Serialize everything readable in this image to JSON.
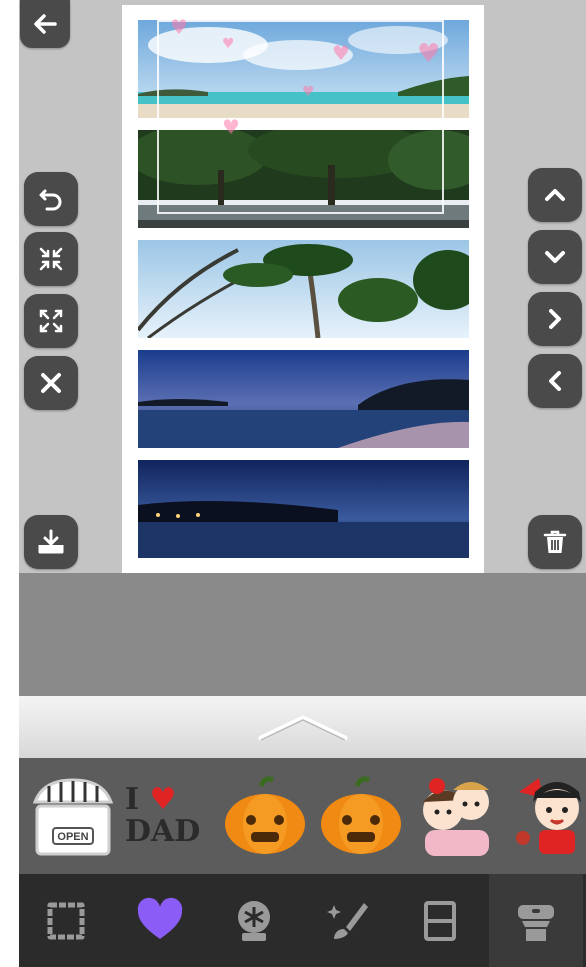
{
  "colors": {
    "toolbar_button": "#4a4a4a",
    "canvas_bg": "#c4c4c4",
    "nav_bg": "#2b2b2b",
    "sticker_bg": "#5c5c5c",
    "heart_accent": "#8b5cf6"
  },
  "stickers": {
    "items": [
      {
        "icon": "shop-awning-icon",
        "sign_text": "OPEN"
      },
      {
        "icon": "i-love-dad-icon",
        "line1": "I",
        "line2": "DAD"
      },
      {
        "icon": "pumpkin-icon"
      },
      {
        "icon": "pumpkin-icon"
      },
      {
        "icon": "cartoon-kids-icon"
      },
      {
        "icon": "cartoon-girl-icon"
      }
    ]
  },
  "nav": {
    "items": [
      {
        "icon": "frame-icon"
      },
      {
        "icon": "heart-icon"
      },
      {
        "icon": "snowglobe-icon"
      },
      {
        "icon": "brush-sparkle-icon"
      },
      {
        "icon": "layout-icon"
      },
      {
        "icon": "stamp-icon"
      }
    ]
  }
}
